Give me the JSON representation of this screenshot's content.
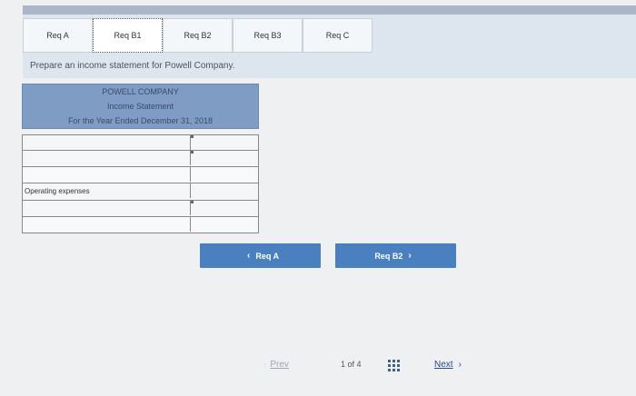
{
  "tabs": [
    {
      "label": "Req A"
    },
    {
      "label": "Req B1"
    },
    {
      "label": "Req B2"
    },
    {
      "label": "Req B3"
    },
    {
      "label": "Req C"
    }
  ],
  "instruction": "Prepare an income statement for Powell Company.",
  "statement": {
    "company": "POWELL COMPANY",
    "title": "Income Statement",
    "period": "For the Year Ended December 31, 2018",
    "rows": [
      {
        "label": ""
      },
      {
        "label": ""
      },
      {
        "label": ""
      },
      {
        "label": "Operating expenses"
      },
      {
        "label": ""
      },
      {
        "label": ""
      }
    ]
  },
  "nav": {
    "prev_button": "Req A",
    "next_button": "Req B2"
  },
  "pager": {
    "prev": "Prev",
    "position": "1 of 4",
    "next": "Next"
  },
  "colors": {
    "accent": "#4a7fc0",
    "header": "#7f9cc4"
  }
}
